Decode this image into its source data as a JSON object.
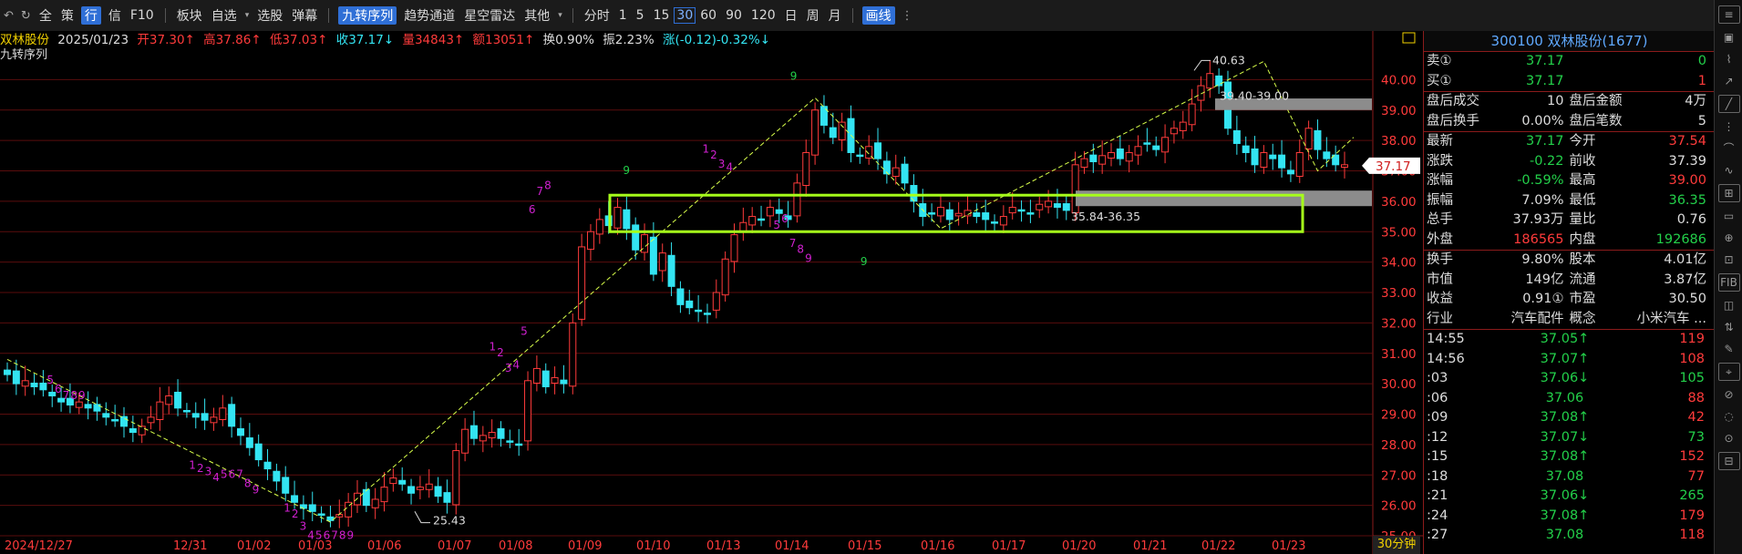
{
  "toolbar": {
    "items": [
      "全",
      "策",
      "行",
      "信",
      "F10",
      "板块",
      "自选",
      "选股",
      "弹幕",
      "九转序列",
      "趋势通道",
      "星空雷达",
      "其他",
      "分时",
      "1",
      "5",
      "15",
      "30",
      "60",
      "90",
      "120",
      "日",
      "周",
      "月",
      "画线"
    ],
    "active_item": "行",
    "active_indicator": "九转序列",
    "selected_period": "30",
    "draw_button": "画线"
  },
  "chart_info": {
    "stock": "双林股份",
    "date": "2025/01/23",
    "open": "开37.30↑",
    "high": "高37.86↑",
    "low": "低37.03↑",
    "close": "收37.17↓",
    "volume": "量34843↑",
    "amount": "额13051↑",
    "turnover": "换0.90%",
    "amplitude": "振2.23%",
    "change": "涨(-0.12)-0.32%↓"
  },
  "indicator_name": "九转序列",
  "period_label": "30分钟",
  "current_price_tag": "37.17",
  "colors": {
    "up": "#ff3b3b",
    "down": "#33e4f2",
    "grid": "#5a0d0d",
    "highlight_box": "#a6ff1a",
    "td_buy": "#d020d0",
    "td_sell": "#23d04a",
    "trend_line": "#d9ff4a"
  },
  "chart_data": {
    "type": "candlestick",
    "title": "",
    "ylim": [
      25.0,
      41.0
    ],
    "y_ticks": [
      "40.00",
      "39.00",
      "38.00",
      "37.00",
      "36.00",
      "35.00",
      "34.00",
      "33.00",
      "32.00",
      "31.00",
      "30.00",
      "29.00",
      "28.00",
      "27.00",
      "26.00",
      "25.00"
    ],
    "x_ticks": [
      "2024/12/27",
      "12/31",
      "01/02",
      "01/03",
      "01/06",
      "01/07",
      "01/08",
      "01/09",
      "01/10",
      "01/13",
      "01/14",
      "01/15",
      "01/16",
      "01/17",
      "01/20",
      "01/21",
      "01/22",
      "01/23"
    ],
    "annotations": {
      "high": "40.63",
      "low": "25.43",
      "upper_zone": "39.40-39.00",
      "lower_zone": "35.84-36.35"
    },
    "highlight_range": [
      35.0,
      36.2
    ],
    "closes": [
      30.3,
      30.0,
      30.1,
      29.9,
      29.8,
      29.6,
      29.4,
      29.3,
      29.4,
      29.2,
      29.1,
      28.9,
      28.8,
      28.6,
      28.4,
      28.6,
      28.9,
      29.4,
      29.6,
      29.2,
      29.1,
      28.9,
      28.8,
      28.9,
      29.2,
      28.6,
      28.3,
      27.9,
      27.5,
      27.2,
      26.8,
      26.4,
      26.1,
      25.9,
      25.8,
      25.7,
      25.5,
      25.7,
      26.1,
      26.4,
      26.0,
      26.2,
      26.6,
      26.9,
      26.7,
      26.4,
      26.6,
      26.7,
      26.3,
      26.1,
      27.8,
      28.5,
      28.2,
      28.3,
      28.4,
      28.2,
      28.1,
      28.0,
      30.1,
      30.5,
      29.9,
      30.2,
      30.0,
      32.0,
      34.5,
      35.0,
      35.4,
      35.2,
      35.8,
      35.1,
      34.4,
      34.9,
      33.6,
      34.3,
      33.2,
      32.6,
      32.5,
      32.4,
      32.3,
      33.0,
      34.1,
      34.9,
      35.3,
      35.5,
      35.4,
      35.8,
      35.6,
      35.4,
      36.6,
      37.6,
      39.0,
      38.5,
      38.1,
      38.6,
      37.6,
      37.5,
      37.8,
      37.4,
      36.9,
      37.1,
      36.6,
      36.0,
      35.5,
      35.6,
      35.8,
      35.4,
      35.6,
      35.7,
      35.5,
      35.4,
      35.3,
      35.5,
      35.8,
      35.7,
      35.6,
      35.9,
      36.0,
      35.8,
      35.7,
      37.2,
      37.4,
      37.3,
      37.5,
      37.6,
      37.4,
      37.6,
      37.8,
      37.9,
      37.7,
      38.1,
      38.4,
      38.6,
      39.2,
      39.8,
      40.2,
      39.8,
      38.4,
      37.9,
      37.6,
      37.2,
      37.6,
      37.4,
      37.1,
      36.9,
      37.6,
      38.4,
      37.7,
      37.4,
      37.2,
      37.2
    ]
  },
  "quote_panel": {
    "title": "300100 双林股份(1677)",
    "rows": [
      {
        "l": "卖①",
        "lv": "37.17",
        "lc": "dn",
        "r": "",
        "rv": "0",
        "rc": "dn"
      },
      {
        "l": "买①",
        "lv": "37.17",
        "lc": "dn",
        "r": "",
        "rv": "1",
        "rc": "up"
      },
      {
        "l": "盘后成交",
        "lv": "10",
        "lc": "wht",
        "r": "盘后金额",
        "rv": "4万",
        "rc": "wht"
      },
      {
        "l": "盘后换手",
        "lv": "0.00%",
        "lc": "wht",
        "r": "盘后笔数",
        "rv": "5",
        "rc": "wht"
      },
      {
        "l": "最新",
        "lv": "37.17",
        "lc": "dn",
        "r": "今开",
        "rv": "37.54",
        "rc": "up",
        "lyel": true
      },
      {
        "l": "涨跌",
        "lv": "-0.22",
        "lc": "dn",
        "r": "前收",
        "rv": "37.39",
        "rc": "wht"
      },
      {
        "l": "涨幅",
        "lv": "-0.59%",
        "lc": "dn",
        "r": "最高",
        "rv": "39.00",
        "rc": "up"
      },
      {
        "l": "振幅",
        "lv": "7.09%",
        "lc": "wht",
        "r": "最低",
        "rv": "36.35",
        "rc": "dn"
      },
      {
        "l": "总手",
        "lv": "37.93万",
        "lc": "wht",
        "r": "量比",
        "rv": "0.76",
        "rc": "wht"
      },
      {
        "l": "外盘",
        "lv": "186565",
        "lc": "up",
        "r": "内盘",
        "rv": "192686",
        "rc": "dn"
      },
      {
        "l": "换手",
        "lv": "9.80%",
        "lc": "wht",
        "r": "股本",
        "rv": "4.01亿",
        "rc": "wht"
      },
      {
        "l": "市值",
        "lv": "149亿",
        "lc": "wht",
        "r": "流通",
        "rv": "3.87亿",
        "rc": "wht"
      },
      {
        "l": "收益",
        "lv": "0.91①",
        "lc": "wht",
        "r": "市盈",
        "rv": "30.50",
        "rc": "wht"
      },
      {
        "l": "行业",
        "lv": "汽车配件",
        "lc": "wht",
        "r": "概念",
        "rv": "小米汽车 ...",
        "rc": "wht",
        "lyel": true,
        "ryel": true
      }
    ],
    "ticks": [
      {
        "t": "14:55",
        "p": "37.05↑",
        "pc": "dn",
        "v": "119",
        "vc": "up"
      },
      {
        "t": "14:56",
        "p": "37.07↑",
        "pc": "dn",
        "v": "108",
        "vc": "up"
      },
      {
        "t": ":03",
        "p": "37.06↓",
        "pc": "dn",
        "v": "105",
        "vc": "dn"
      },
      {
        "t": ":06",
        "p": "37.06",
        "pc": "dn",
        "v": "88",
        "vc": "up"
      },
      {
        "t": ":09",
        "p": "37.08↑",
        "pc": "dn",
        "v": "42",
        "vc": "up"
      },
      {
        "t": ":12",
        "p": "37.07↓",
        "pc": "dn",
        "v": "73",
        "vc": "dn"
      },
      {
        "t": ":15",
        "p": "37.08↑",
        "pc": "dn",
        "v": "152",
        "vc": "up"
      },
      {
        "t": ":18",
        "p": "37.08",
        "pc": "dn",
        "v": "77",
        "vc": "up"
      },
      {
        "t": ":21",
        "p": "37.06↓",
        "pc": "dn",
        "v": "265",
        "vc": "dn"
      },
      {
        "t": ":24",
        "p": "37.08↑",
        "pc": "dn",
        "v": "179",
        "vc": "up"
      },
      {
        "t": ":27",
        "p": "37.08",
        "pc": "dn",
        "v": "118",
        "vc": "up"
      }
    ]
  },
  "right_toolbar": [
    "≡",
    "▣",
    "⌇",
    "↗",
    "╱",
    "⋮",
    "⌒",
    "∿",
    "⊞",
    "▭",
    "⊕",
    "⊡",
    "FIB",
    "◫",
    "⇅",
    "✎",
    "⌖",
    "⊘",
    "◌",
    "⊙",
    "⊟"
  ]
}
